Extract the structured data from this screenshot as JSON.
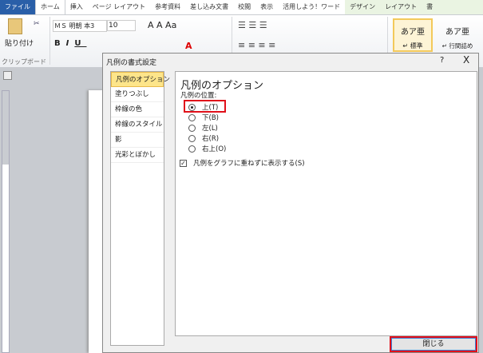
{
  "ribbon_tabs": [
    "ファイル",
    "ホーム",
    "挿入",
    "ページ レイアウト",
    "参考資料",
    "差し込み文書",
    "校閲",
    "表示",
    "活用しよう！ワード",
    "デザイン",
    "レイアウト",
    "書"
  ],
  "ribbon": {
    "paste": "貼り付け",
    "clipboard": "クリップボード",
    "font": "ＭＳ 明朝 本3",
    "size": "10",
    "style1": "あア亜",
    "style1_label": "↵ 標準",
    "style2": "あア亜",
    "style2_label": "↵ 行間詰め"
  },
  "dialog": {
    "title": "凡例の書式設定",
    "help": "?",
    "close_x": "X",
    "nav": [
      "凡例のオプション",
      "塗りつぶし",
      "枠線の色",
      "枠線のスタイル",
      "影",
      "光彩とぼかし"
    ],
    "panel_title": "凡例のオプション",
    "position_label": "凡例の位置:",
    "options": [
      "上(T)",
      "下(B)",
      "左(L)",
      "右(R)",
      "右上(O)"
    ],
    "selected": 0,
    "checkbox_label": "凡例をグラフに重ねずに表示する(S)",
    "checkbox_checked": true,
    "close_button": "閉じる"
  }
}
